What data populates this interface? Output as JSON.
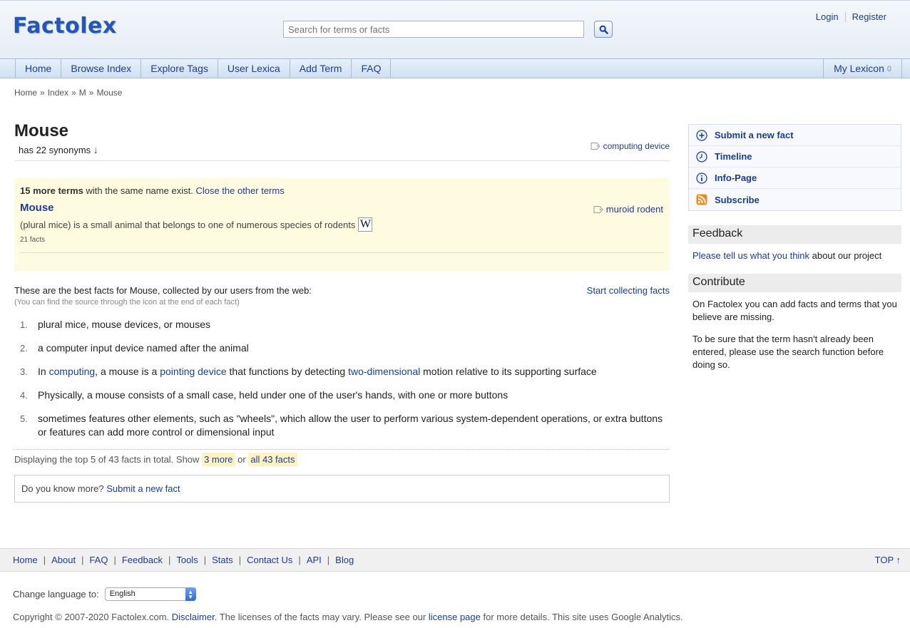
{
  "header": {
    "logo": "Factolex",
    "search_placeholder": "Search for terms or facts",
    "login": "Login",
    "register": "Register"
  },
  "nav": {
    "items": [
      {
        "label": "Home"
      },
      {
        "label": "Browse Index"
      },
      {
        "label": "Explore Tags"
      },
      {
        "label": "User Lexica"
      },
      {
        "label": "Add Term"
      },
      {
        "label": "FAQ"
      }
    ],
    "my_lexicon": "My Lexicon",
    "my_lexicon_count": "0"
  },
  "breadcrumb": [
    "Home",
    "Index",
    "M",
    "Mouse"
  ],
  "term": {
    "title": "Mouse",
    "synonyms_text": "has 22 synonyms",
    "synonyms_arrow": "↓",
    "tag": "computing device"
  },
  "other_terms": {
    "count_text": "15 more terms",
    "notice_text": "with the same name exist.",
    "close_link": "Close the other terms",
    "items": [
      {
        "title": "Mouse",
        "tag": "muroid rodent",
        "description": "(plural mice) is a small animal that belongs to one of numerous species of rodents",
        "wiki_icon": "W",
        "facts_count": "21 facts"
      }
    ]
  },
  "facts_intro": {
    "line1": "These are the best facts for Mouse, collected by our users from the web:",
    "line2": "(You can find the source through the icon at the end of each fact)",
    "start_link": "Start collecting facts"
  },
  "facts": [
    {
      "num": "1.",
      "text": "plural mice, mouse devices, or mouses"
    },
    {
      "num": "2.",
      "text": "a computer input device named after the animal"
    },
    {
      "num": "3.",
      "parts": {
        "a": "In ",
        "link1": "computing",
        "b": ", a mouse is a ",
        "link2": "pointing device",
        "c": " that functions by detecting ",
        "link3": "two-dimensional",
        "d": " motion relative to its supporting surface"
      }
    },
    {
      "num": "4.",
      "text": "Physically, a mouse consists of a small case, held under one of the user's hands, with one or more buttons"
    },
    {
      "num": "5.",
      "text": "sometimes features other elements, such as \"wheels\", which allow the user to perform various system-dependent operations, or extra buttons or features can add more control or dimensional input"
    }
  ],
  "display": {
    "text": "Displaying the top 5 of 43 facts in total. Show",
    "more_link": "3 more",
    "or": "or",
    "all_link": "all 43 facts"
  },
  "know_more": {
    "text": "Do you know more?",
    "link": "Submit a new fact"
  },
  "sidebar": {
    "actions": [
      {
        "label": "Submit a new fact",
        "icon": "plus-circle-icon"
      },
      {
        "label": "Timeline",
        "icon": "clock-icon"
      },
      {
        "label": "Info-Page",
        "icon": "info-icon"
      },
      {
        "label": "Subscribe",
        "icon": "rss-icon"
      }
    ],
    "feedback_title": "Feedback",
    "feedback_link": "Please tell us what you think",
    "feedback_rest": "about our project",
    "contribute_title": "Contribute",
    "contribute_p1": "On Factolex you can add facts and terms that you believe are missing.",
    "contribute_p2": "To be sure that the term hasn't already been entered, please use the search function before doing so."
  },
  "footer": {
    "links": [
      "Home",
      "About",
      "FAQ",
      "Feedback",
      "Tools",
      "Stats",
      "Contact Us",
      "API",
      "Blog"
    ],
    "top": "TOP ↑",
    "language_label": "Change language to:",
    "language_value": "English",
    "copyright_a": "Copyright © 2007-2020 Factolex.com.",
    "disclaimer": "Disclaimer",
    "copyright_b": ". The licenses of the facts may vary. Please see our",
    "license_link": "license page",
    "copyright_c": "for more details. This site uses Google Analytics."
  },
  "colors": {
    "link": "#1a3d99",
    "highlight": "#fffbe0",
    "pill": "#fff4bf"
  }
}
